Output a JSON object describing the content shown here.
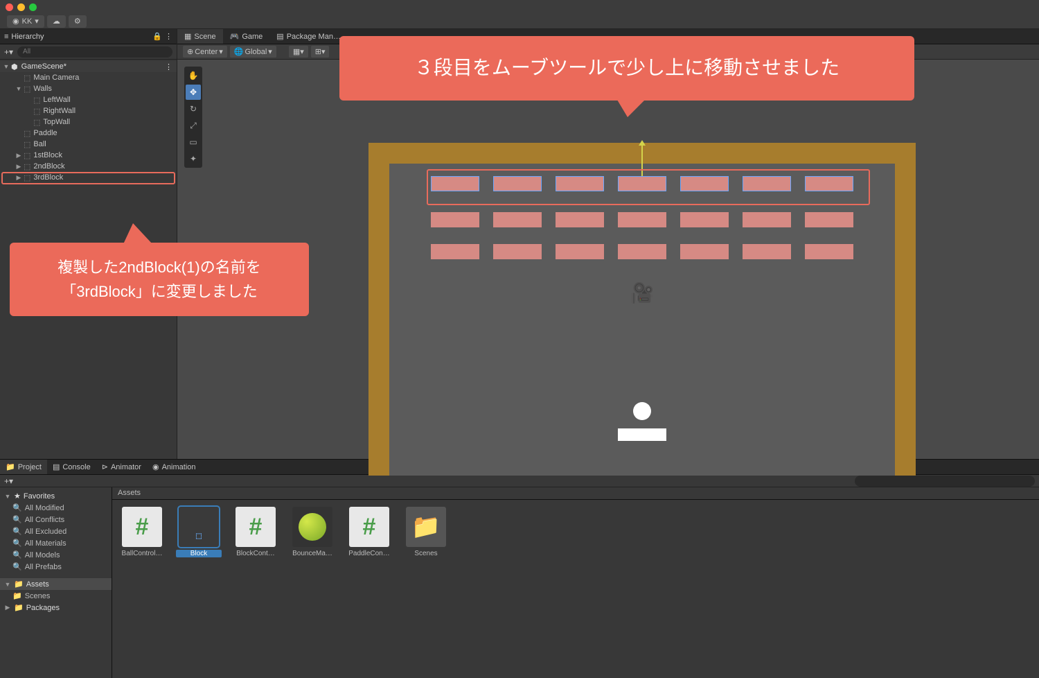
{
  "window": {
    "user": "KK"
  },
  "hierarchy": {
    "title": "Hierarchy",
    "search_placeholder": "All",
    "scene": "GameScene*",
    "items": [
      {
        "name": "Main Camera",
        "depth": 1
      },
      {
        "name": "Walls",
        "depth": 1,
        "expandable": true,
        "expanded": true
      },
      {
        "name": "LeftWall",
        "depth": 2
      },
      {
        "name": "RightWall",
        "depth": 2
      },
      {
        "name": "TopWall",
        "depth": 2
      },
      {
        "name": "Paddle",
        "depth": 1
      },
      {
        "name": "Ball",
        "depth": 1
      },
      {
        "name": "1stBlock",
        "depth": 1,
        "expandable": true
      },
      {
        "name": "2ndBlock",
        "depth": 1,
        "expandable": true
      },
      {
        "name": "3rdBlock",
        "depth": 1,
        "expandable": true,
        "highlighted": true
      }
    ]
  },
  "scene_tabs": {
    "scene": "Scene",
    "game": "Game",
    "pkg": "Package Man…"
  },
  "scene_toolbar": {
    "center": "Center",
    "global": "Global"
  },
  "project": {
    "tabs": {
      "project": "Project",
      "console": "Console",
      "animator": "Animator",
      "animation": "Animation"
    },
    "favorites": "Favorites",
    "fav_items": [
      "All Modified",
      "All Conflicts",
      "All Excluded",
      "All Materials",
      "All Models",
      "All Prefabs"
    ],
    "assets_root": "Assets",
    "assets_children": [
      "Scenes"
    ],
    "packages": "Packages",
    "breadcrumb": "Assets",
    "assets": [
      {
        "label": "BallControl…",
        "type": "cs"
      },
      {
        "label": "Block",
        "type": "prefab",
        "selected": true
      },
      {
        "label": "BlockCont…",
        "type": "cs"
      },
      {
        "label": "BounceMa…",
        "type": "mat"
      },
      {
        "label": "PaddleCon…",
        "type": "cs"
      },
      {
        "label": "Scenes",
        "type": "folder"
      }
    ]
  },
  "annotations": {
    "top": "３段目をムーブツールで少し上に移動させました",
    "left_l1": "複製した2ndBlock(1)の名前を",
    "left_l2": "「3rdBlock」に変更しました"
  }
}
